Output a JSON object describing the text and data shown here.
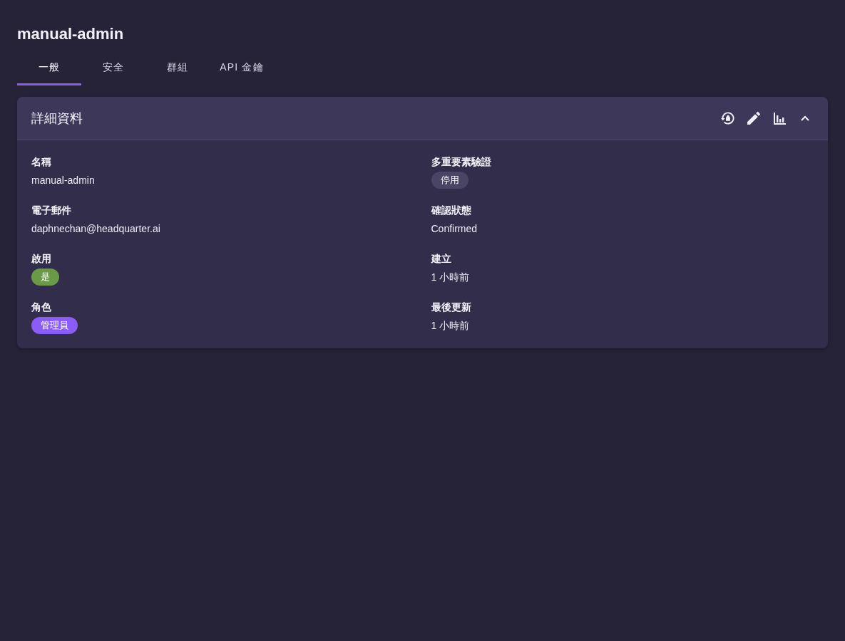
{
  "page_title": "manual-admin",
  "tabs": [
    {
      "label": "一般",
      "selected": true
    },
    {
      "label": "安全",
      "selected": false
    },
    {
      "label": "群組",
      "selected": false
    },
    {
      "label": "API 金鑰",
      "selected": false
    }
  ],
  "details_card": {
    "title": "詳細資料",
    "expanded": true,
    "columns": [
      [
        {
          "kind": "text",
          "label": "名稱",
          "value": "manual-admin"
        },
        {
          "kind": "text",
          "label": "電子郵件",
          "value": "daphnechan@headquarter.ai"
        },
        {
          "kind": "chip",
          "label": "啟用",
          "value": "是",
          "color": "#6a9a48"
        },
        {
          "kind": "chip",
          "label": "角色",
          "value": "管理員",
          "color": "#8b5cf6"
        }
      ],
      [
        {
          "kind": "chip",
          "label": "多重要素驗證",
          "value": "停用",
          "color": "#4a4565"
        },
        {
          "kind": "text",
          "label": "確認狀態",
          "value": "Confirmed"
        },
        {
          "kind": "text",
          "label": "建立",
          "value": "1 小時前"
        },
        {
          "kind": "text",
          "label": "最後更新",
          "value": "1 小時前"
        }
      ]
    ]
  }
}
